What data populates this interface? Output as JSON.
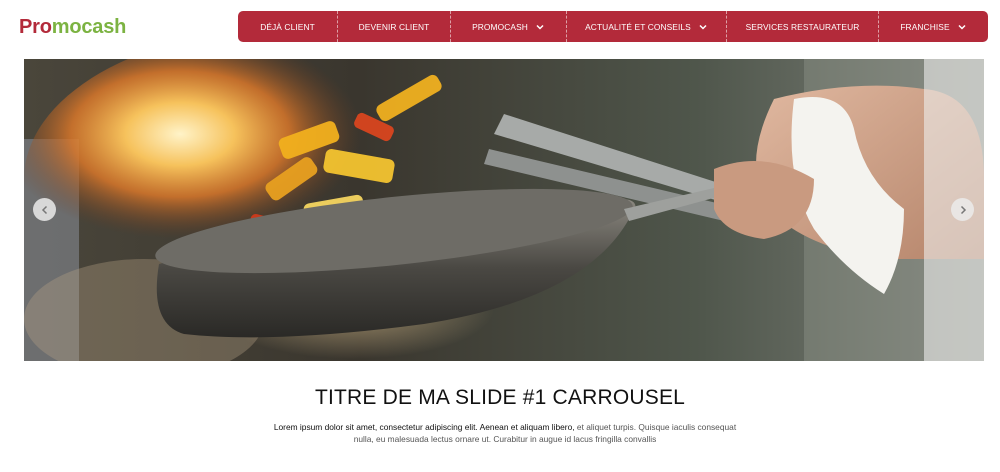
{
  "brand": {
    "logo_part1": "Pro",
    "logo_part2": "mocash"
  },
  "nav": {
    "items": [
      {
        "label": "DÉJÀ CLIENT",
        "dropdown": false
      },
      {
        "label": "DEVENIR CLIENT",
        "dropdown": false
      },
      {
        "label": "PROMOCASH",
        "dropdown": true
      },
      {
        "label": "ACTUALITÉ ET CONSEILS",
        "dropdown": true
      },
      {
        "label": "SERVICES RESTAURATEUR",
        "dropdown": false
      },
      {
        "label": "FRANCHISE",
        "dropdown": true
      }
    ]
  },
  "carousel": {
    "prev_icon": "chevron-left-icon",
    "next_icon": "chevron-right-icon",
    "slide_title": "TITRE DE MA SLIDE #1 CARROUSEL",
    "slide_desc_lead": "Lorem ipsum dolor sit amet, consectetur adipiscing elit. Aenean et aliquam libero,",
    "slide_desc_rest": " et aliquet turpis. Quisque iaculis consequat nulla, eu malesuada lectus ornare ut. Curabitur in augue id lacus fringilla convallis"
  },
  "colors": {
    "brand_red": "#b32a3a",
    "brand_green": "#7cb342"
  }
}
